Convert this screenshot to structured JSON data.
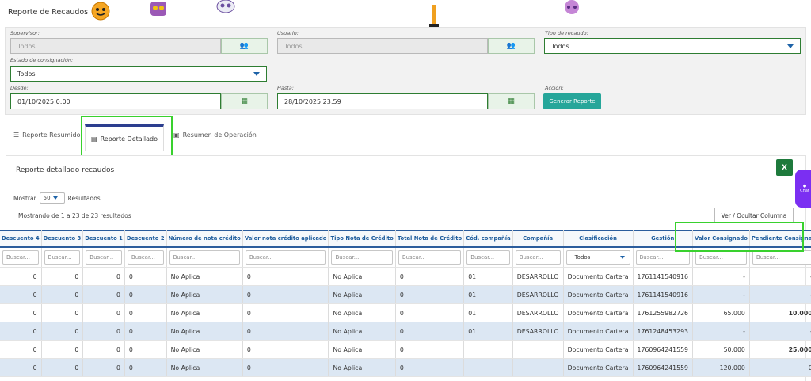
{
  "page": {
    "title": "Reporte de Recaudos"
  },
  "filters": {
    "supervisor": {
      "label": "Supervisor:",
      "value": "Todos"
    },
    "usuario": {
      "label": "Usuario:",
      "value": "Todos"
    },
    "tipo_recaudo": {
      "label": "Tipo de recaudo:",
      "value": "Todos"
    },
    "estado": {
      "label": "Estado de consignación:",
      "value": "Todos"
    },
    "desde": {
      "label": "Desde:",
      "value": "01/10/2025 0:00"
    },
    "hasta": {
      "label": "Hasta:",
      "value": "28/10/2025 23:59"
    },
    "accion": {
      "label": "Acción:",
      "button": "Generar Reporte"
    }
  },
  "tabs": [
    {
      "label": "Reporte Resumido",
      "icon": "list-icon"
    },
    {
      "label": "Reporte Detallado",
      "icon": "table-icon"
    },
    {
      "label": "Resumen de Operación",
      "icon": "money-icon"
    }
  ],
  "panel": {
    "title": "Reporte detallado recaudos",
    "excel_label": "X",
    "show_prefix": "Mostrar",
    "page_size": "50",
    "show_suffix": "Resultados",
    "showing": "Mostrando de 1 a 23 de 23 resultados",
    "columns_button": "Ver / Ocultar Columna",
    "chat_label": "Chat"
  },
  "table": {
    "headers": [
      "Descuento 4",
      "Descuento 3",
      "Descuento 1",
      "Descuento 2",
      "Número de nota crédito",
      "Valor nota crédito aplicado",
      "Tipo Nota de Crédito",
      "Total Nota de Crédito",
      "Cód. compañía",
      "Compañía",
      "Clasificación",
      "Gestión",
      "Valor Consignado",
      "Pendiente Consignar"
    ],
    "search_placeholder": "Buscar...",
    "clasificacion_filter": "Todos",
    "rows": [
      [
        "0",
        "0",
        "0",
        "0",
        "No Aplica",
        "0",
        "No Aplica",
        "0",
        "01",
        "DESARROLLO",
        "Documento Cartera",
        "1761141540916",
        "-",
        "-"
      ],
      [
        "0",
        "0",
        "0",
        "0",
        "No Aplica",
        "0",
        "No Aplica",
        "0",
        "01",
        "DESARROLLO",
        "Documento Cartera",
        "1761141540916",
        "-",
        "-"
      ],
      [
        "0",
        "0",
        "0",
        "0",
        "No Aplica",
        "0",
        "No Aplica",
        "0",
        "01",
        "DESARROLLO",
        "Documento Cartera",
        "1761255982726",
        "65.000",
        "10.000"
      ],
      [
        "0",
        "0",
        "0",
        "0",
        "No Aplica",
        "0",
        "No Aplica",
        "0",
        "01",
        "DESARROLLO",
        "Documento Cartera",
        "1761248453293",
        "-",
        "-"
      ],
      [
        "0",
        "0",
        "0",
        "0",
        "No Aplica",
        "0",
        "No Aplica",
        "0",
        "",
        "",
        "Documento Cartera",
        "1760964241559",
        "50.000",
        "25.000"
      ],
      [
        "0",
        "0",
        "0",
        "0",
        "No Aplica",
        "0",
        "No Aplica",
        "0",
        "",
        "",
        "Documento Cartera",
        "1760964241559",
        "120.000",
        "0"
      ]
    ],
    "bold_pending_rows": [
      2,
      4
    ]
  }
}
